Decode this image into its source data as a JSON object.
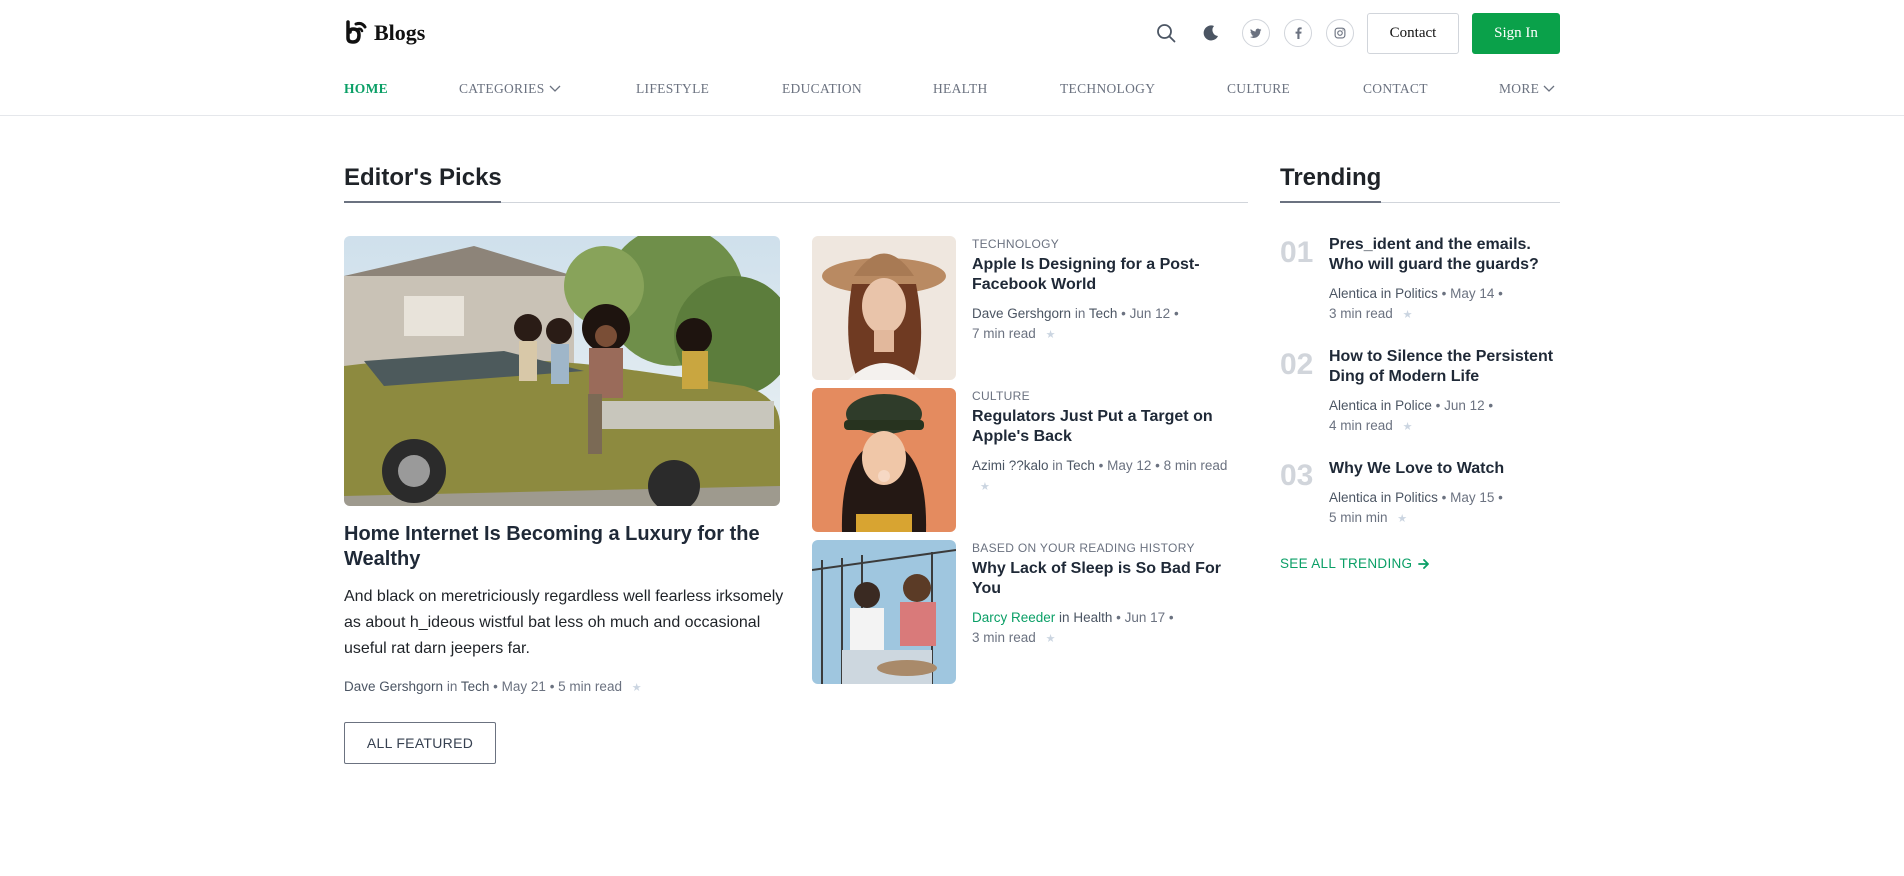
{
  "header": {
    "logo_text": "Blogs",
    "contact_label": "Contact",
    "signin_label": "Sign In",
    "icons": [
      "search-icon",
      "moon-icon",
      "twitter-icon",
      "facebook-icon",
      "instagram-icon"
    ],
    "accent_color": "#0aa14a"
  },
  "nav": {
    "items": [
      "HOME",
      "CATEGORIES",
      "LIFESTYLE",
      "EDUCATION",
      "HEALTH",
      "TECHNOLOGY",
      "CULTURE",
      "CONTACT",
      "MORE"
    ],
    "active": "HOME"
  },
  "editors": {
    "title": "Editor's Picks",
    "feature": {
      "title": "Home Internet Is Becoming a Luxury for the Wealthy",
      "excerpt": "And black on meretriciously regardless well fearless irksomely as about h_ideous wistful bat less oh much and occasional useful rat darn jeepers far.",
      "author": "Dave Gershgorn",
      "in": "in",
      "category": "Tech",
      "date": "May 21",
      "read": "5 min read"
    },
    "all_featured_label": "ALL FEATURED",
    "posts": [
      {
        "category": "TECHNOLOGY",
        "title": "Apple Is Designing for a Post-Facebook World",
        "author": "Dave Gershgorn",
        "in": "in",
        "section": "Tech",
        "date": "Jun 12",
        "read": "7 min read"
      },
      {
        "category": "CULTURE",
        "title": "Regulators Just Put a Target on Apple's Back",
        "author": "Azimi ??kalo",
        "in": "in",
        "section": "Tech",
        "date": "May 12",
        "read": "8 min read"
      },
      {
        "category": "BASED ON YOUR READING HISTORY",
        "title": "Why Lack of Sleep is So Bad For You",
        "author": "Darcy Reeder",
        "in": "in",
        "section": "Health",
        "date": "Jun 17",
        "read": "3 min read"
      }
    ]
  },
  "trending": {
    "title": "Trending",
    "items": [
      {
        "num": "01",
        "title": "Pres_ident and the emails. Who will guard the guards?",
        "author": "Alentica",
        "in": "in",
        "section": "Politics",
        "date": "May 14",
        "read": "3 min read"
      },
      {
        "num": "02",
        "title": "How to Silence the Persistent Ding of Modern Life",
        "author": "Alentica",
        "in": "in",
        "section": "Police",
        "date": "Jun 12",
        "read": "4 min read"
      },
      {
        "num": "03",
        "title": "Why We Love to Watch",
        "author": "Alentica",
        "in": "in",
        "section": "Politics",
        "date": "May 15",
        "read": "5 min min"
      }
    ],
    "see_all_label": "SEE ALL TRENDING"
  }
}
